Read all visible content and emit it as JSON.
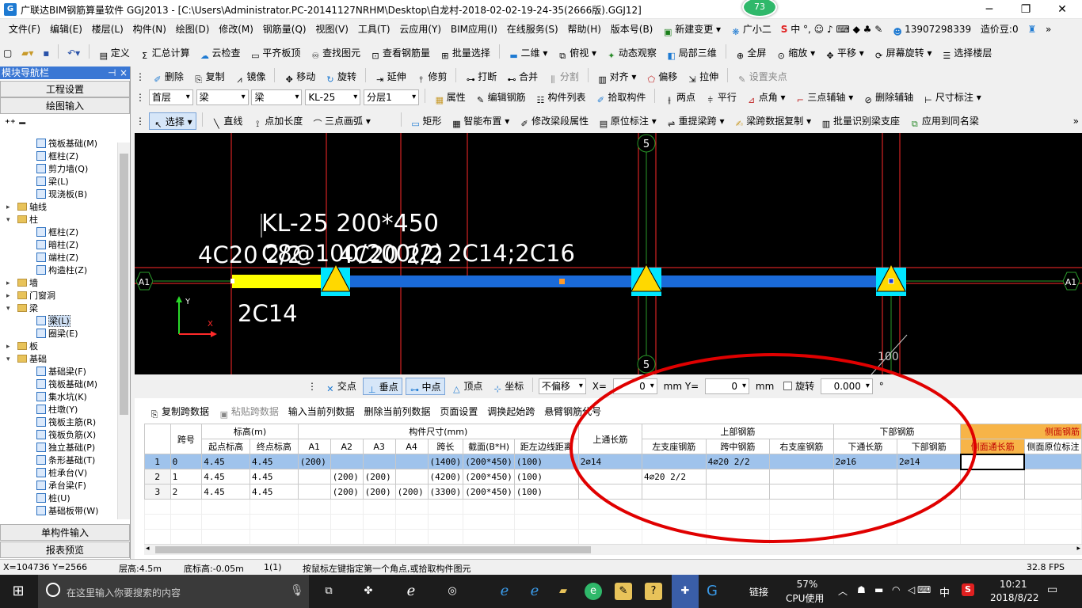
{
  "window": {
    "title": "广联达BIM钢筋算量软件 GGJ2013 - [C:\\Users\\Administrator.PC-20141127NRHM\\Desktop\\白龙村-2018-02-02-19-24-35(2666版).GGJ12]",
    "badge": "73"
  },
  "menu": [
    "文件(F)",
    "编辑(E)",
    "楼层(L)",
    "构件(N)",
    "绘图(D)",
    "修改(M)",
    "钢筋量(Q)",
    "视图(V)",
    "工具(T)",
    "云应用(Y)",
    "BIM应用(I)",
    "在线服务(S)",
    "帮助(H)",
    "版本号(B)",
    "新建变更",
    "广小二"
  ],
  "menu_right": {
    "phone": "13907298339",
    "coins": "造价豆:0",
    "ime": "中"
  },
  "toolbar1": [
    "定义",
    "汇总计算",
    "云检查",
    "平齐板顶",
    "查找图元",
    "查看钢筋量",
    "批量选择",
    "二维",
    "俯视",
    "动态观察",
    "局部三维",
    "全屏",
    "缩放",
    "平移",
    "屏幕旋转",
    "选择楼层"
  ],
  "toolbar2": [
    "删除",
    "复制",
    "镜像",
    "移动",
    "旋转",
    "延伸",
    "修剪",
    "打断",
    "合并",
    "分割",
    "对齐",
    "偏移",
    "拉伸",
    "设置夹点"
  ],
  "toolbar3": {
    "dropdowns": [
      "首层",
      "梁",
      "梁",
      "KL-25",
      "分层1"
    ],
    "buttons": [
      "属性",
      "编辑钢筋",
      "构件列表",
      "拾取构件",
      "两点",
      "平行",
      "点角",
      "三点辅轴",
      "删除辅轴",
      "尺寸标注"
    ]
  },
  "toolbar4": [
    "选择",
    "直线",
    "点加长度",
    "三点画弧",
    "矩形",
    "智能布置",
    "修改梁段属性",
    "原位标注",
    "重提梁跨",
    "梁跨数据复制",
    "批量识别梁支座",
    "应用到同名梁"
  ],
  "nav": {
    "header": "模块导航栏",
    "pin": "ꟸ",
    "close": "×",
    "buttons": [
      "工程设置",
      "绘图输入"
    ],
    "bottom_buttons": [
      "单构件输入",
      "报表预览"
    ],
    "tree": [
      {
        "label": "筏板基础(M)",
        "level": 2,
        "type": "leaf"
      },
      {
        "label": "框柱(Z)",
        "level": 2,
        "type": "leaf"
      },
      {
        "label": "剪力墙(Q)",
        "level": 2,
        "type": "leaf"
      },
      {
        "label": "梁(L)",
        "level": 2,
        "type": "leaf"
      },
      {
        "label": "现浇板(B)",
        "level": 2,
        "type": "leaf"
      },
      {
        "label": "轴线",
        "level": 1,
        "type": "folder",
        "tw": "▸"
      },
      {
        "label": "柱",
        "level": 1,
        "type": "folder",
        "tw": "▾"
      },
      {
        "label": "框柱(Z)",
        "level": 2,
        "type": "leaf"
      },
      {
        "label": "暗柱(Z)",
        "level": 2,
        "type": "leaf"
      },
      {
        "label": "端柱(Z)",
        "level": 2,
        "type": "leaf"
      },
      {
        "label": "构造柱(Z)",
        "level": 2,
        "type": "leaf"
      },
      {
        "label": "墙",
        "level": 1,
        "type": "folder",
        "tw": "▸"
      },
      {
        "label": "门窗洞",
        "level": 1,
        "type": "folder",
        "tw": "▸"
      },
      {
        "label": "梁",
        "level": 1,
        "type": "folder",
        "tw": "▾"
      },
      {
        "label": "梁(L)",
        "level": 2,
        "type": "leaf",
        "sel": true
      },
      {
        "label": "圈梁(E)",
        "level": 2,
        "type": "leaf"
      },
      {
        "label": "板",
        "level": 1,
        "type": "folder",
        "tw": "▸"
      },
      {
        "label": "基础",
        "level": 1,
        "type": "folder",
        "tw": "▾"
      },
      {
        "label": "基础梁(F)",
        "level": 2,
        "type": "leaf"
      },
      {
        "label": "筏板基础(M)",
        "level": 2,
        "type": "leaf"
      },
      {
        "label": "集水坑(K)",
        "level": 2,
        "type": "leaf"
      },
      {
        "label": "柱墩(Y)",
        "level": 2,
        "type": "leaf"
      },
      {
        "label": "筏板主筋(R)",
        "level": 2,
        "type": "leaf"
      },
      {
        "label": "筏板负筋(X)",
        "level": 2,
        "type": "leaf"
      },
      {
        "label": "独立基础(P)",
        "level": 2,
        "type": "leaf"
      },
      {
        "label": "条形基础(T)",
        "level": 2,
        "type": "leaf"
      },
      {
        "label": "桩承台(V)",
        "level": 2,
        "type": "leaf"
      },
      {
        "label": "承台梁(F)",
        "level": 2,
        "type": "leaf"
      },
      {
        "label": "桩(U)",
        "level": 2,
        "type": "leaf"
      },
      {
        "label": "基础板带(W)",
        "level": 2,
        "type": "leaf"
      }
    ]
  },
  "canvas": {
    "beam_name": "KL-25 200*450",
    "beam_spec": "C8@100/200(2)",
    "beam_rebar": "2C14;2C16",
    "support_rebar": "4C20 2/2",
    "mid_rebar": "4C20 2/2",
    "bottom_label": "2C14",
    "axis_top": "5",
    "axis_bottom": "5",
    "axis_left": "A1",
    "axis_right": "A1",
    "dimension": "100",
    "ucs_x": "X",
    "ucs_y": "Y"
  },
  "snap": {
    "items": [
      "交点",
      "垂点",
      "中点",
      "顶点",
      "坐标"
    ],
    "offset_mode": "不偏移",
    "x_label": "X=",
    "x_value": "0",
    "y_label": "mm Y=",
    "y_value": "0",
    "unit": "mm",
    "rotate_label": "旋转",
    "rotate_value": "0.000",
    "degree": "°"
  },
  "grid_toolbar": [
    "复制跨数据",
    "粘贴跨数据",
    "输入当前列数据",
    "删除当前列数据",
    "页面设置",
    "调换起始跨",
    "悬臂钢筋代号"
  ],
  "table": {
    "group_headers": {
      "kuahao": "跨号",
      "biaogao": "标高(m)",
      "chicun": "构件尺寸(mm)",
      "shangtong": "上通长筋",
      "shangbu": "上部钢筋",
      "xiabu": "下部钢筋",
      "cemian": "侧面钢筋"
    },
    "sub_headers": [
      "起点标高",
      "终点标高",
      "A1",
      "A2",
      "A3",
      "A4",
      "跨长",
      "截面(B*H)",
      "距左边线距离",
      "左支座钢筋",
      "跨中钢筋",
      "右支座钢筋",
      "下通长筋",
      "下部钢筋",
      "侧面通长筋",
      "侧面原位标注"
    ],
    "rows": [
      {
        "no": "1",
        "kua": "0",
        "qd": "4.45",
        "zd": "4.45",
        "a1": "(200)",
        "a2": "",
        "a3": "",
        "a4": "",
        "kc": "(1400)",
        "jm": "(200*450)",
        "jl": "(100)",
        "stc": "2⌀14",
        "zz": "",
        "kz": "4⌀20 2/2",
        "yz": "",
        "xtc": "2⌀16",
        "xb": "2⌀14",
        "cmtc": "",
        "cmyw": ""
      },
      {
        "no": "2",
        "kua": "1",
        "qd": "4.45",
        "zd": "4.45",
        "a1": "",
        "a2": "(200)",
        "a3": "(200)",
        "a4": "",
        "kc": "(4200)",
        "jm": "(200*450)",
        "jl": "(100)",
        "stc": "",
        "zz": "4⌀20 2/2",
        "kz": "",
        "yz": "",
        "xtc": "",
        "xb": "",
        "cmtc": "",
        "cmyw": ""
      },
      {
        "no": "3",
        "kua": "2",
        "qd": "4.45",
        "zd": "4.45",
        "a1": "",
        "a2": "(200)",
        "a3": "(200)",
        "a4": "(200)",
        "kc": "(3300)",
        "jm": "(200*450)",
        "jl": "(100)",
        "stc": "",
        "zz": "",
        "kz": "",
        "yz": "",
        "xtc": "",
        "xb": "",
        "cmtc": "",
        "cmyw": ""
      }
    ]
  },
  "status": {
    "coords": "X=104736 Y=2566",
    "floor_height": "层高:4.5m",
    "base_height": "底标高:-0.05m",
    "count": "1(1)",
    "hint": "按鼠标左键指定第一个角点,或拾取构件图元",
    "fps": "32.8 FPS"
  },
  "taskbar": {
    "search_placeholder": "在这里输入你要搜索的内容",
    "link_label": "链接",
    "cpu_percent": "57%",
    "cpu_label": "CPU使用",
    "ime": "中",
    "time": "10:21",
    "date": "2018/8/22"
  },
  "colors": {
    "canvas_bg": "#000000",
    "beam_blue": "#1a6ad8",
    "beam_yellow": "#ffff00",
    "axis_red": "#ff2a2a",
    "annotation_ellipse": "#e00000",
    "nav_header": "#3a77d4",
    "selected_row": "#9fc3ec",
    "side_header": "#f7b448"
  }
}
